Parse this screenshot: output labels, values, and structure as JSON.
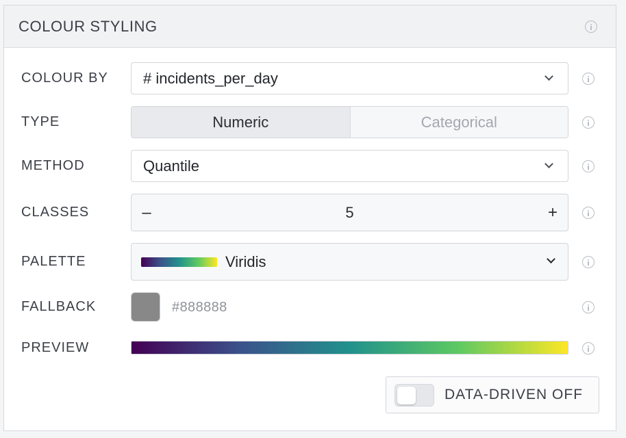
{
  "panel": {
    "title": "COLOUR STYLING"
  },
  "fields": {
    "colour_by": {
      "label": "COLOUR BY",
      "value": "# incidents_per_day"
    },
    "type": {
      "label": "TYPE",
      "options": [
        "Numeric",
        "Categorical"
      ],
      "selected": "Numeric"
    },
    "method": {
      "label": "METHOD",
      "value": "Quantile"
    },
    "classes": {
      "label": "CLASSES",
      "value": "5",
      "decrement": "–",
      "increment": "+"
    },
    "palette": {
      "label": "PALETTE",
      "value": "Viridis"
    },
    "fallback": {
      "label": "FALLBACK",
      "value": "#888888"
    },
    "preview": {
      "label": "PREVIEW"
    }
  },
  "toggle": {
    "label": "DATA-DRIVEN OFF",
    "on": false
  },
  "colors": {
    "fallback_swatch": "#888888",
    "viridis": [
      "#440154",
      "#3b528b",
      "#21918c",
      "#5ec962",
      "#fde725"
    ]
  },
  "icons": {
    "info": "info-circle-icon",
    "dropdown": "chevron-down-icon"
  }
}
